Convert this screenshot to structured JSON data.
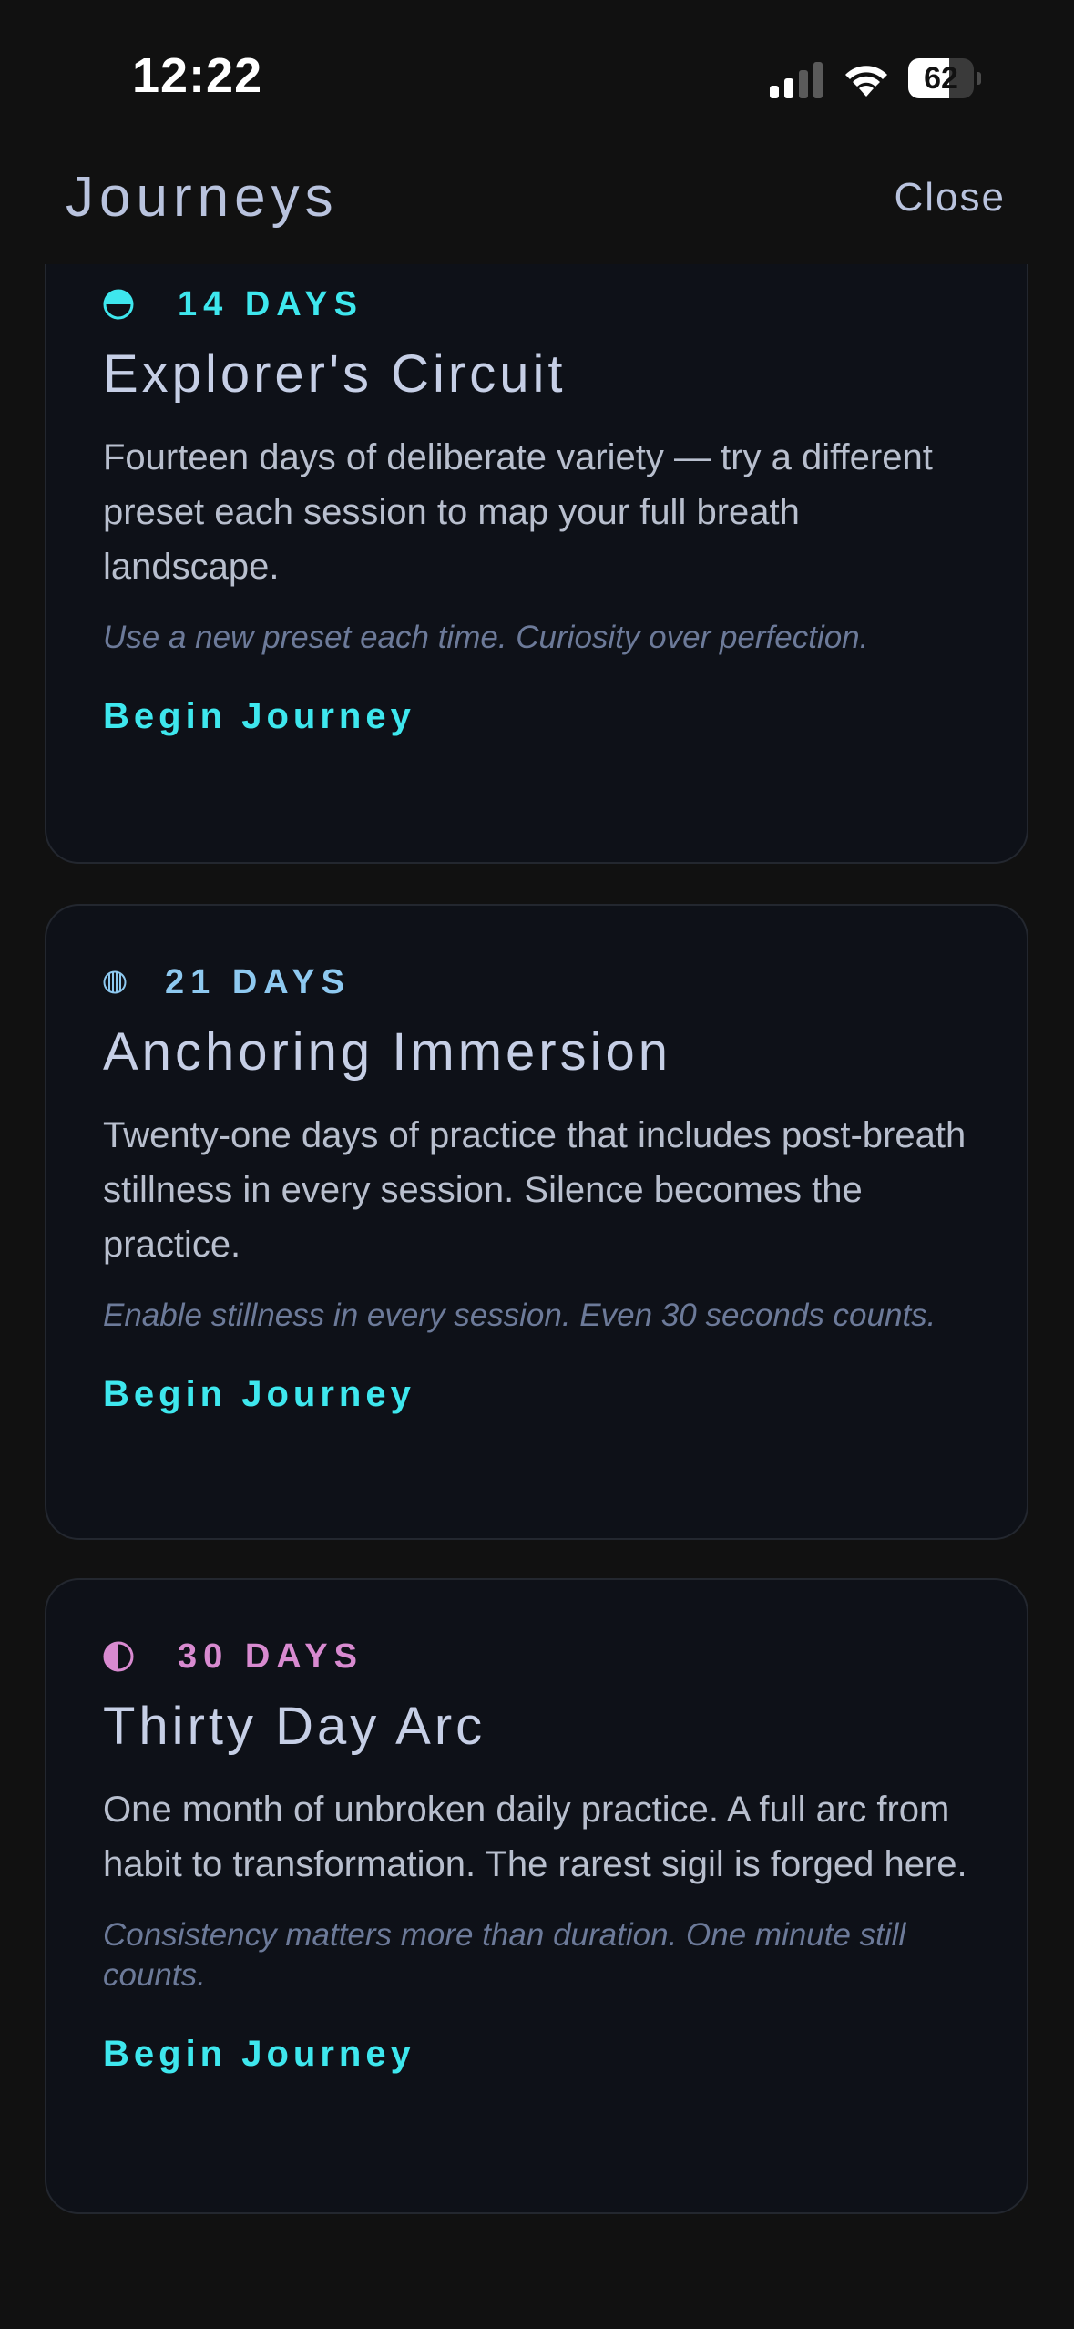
{
  "status_bar": {
    "time": "12:22",
    "battery_percent": 62,
    "battery_text": "62",
    "signal_icon": "cellular-signal-icon",
    "wifi_icon": "wifi-icon"
  },
  "header": {
    "title": "Journeys",
    "close_label": "Close"
  },
  "journeys": [
    {
      "days_label": "14 DAYS",
      "icon": "half-moon-icon",
      "accent": "#3ee7ee",
      "title": "Explorer's Circuit",
      "description": "Fourteen days of deliberate variety — try a different preset each session to map your full breath landscape.",
      "hint": "Use a new preset each time. Curiosity over perfection.",
      "button_label": "Begin Journey"
    },
    {
      "days_label": "21 DAYS",
      "icon": "striped-circle-icon",
      "accent": "#8ec9f0",
      "title": "Anchoring Immersion",
      "description": "Twenty-one days of practice that includes post-breath stillness in every session. Silence becomes the practice.",
      "hint": "Enable stillness in every session. Even 30 seconds counts.",
      "button_label": "Begin Journey"
    },
    {
      "days_label": "30 DAYS",
      "icon": "half-circle-icon",
      "accent": "#d88ad0",
      "title": "Thirty Day Arc",
      "description": "One month of unbroken daily practice. A full arc from habit to transformation. The rarest sigil is forged here.",
      "hint": "Consistency matters more than duration. One minute still counts.",
      "button_label": "Begin Journey"
    }
  ]
}
